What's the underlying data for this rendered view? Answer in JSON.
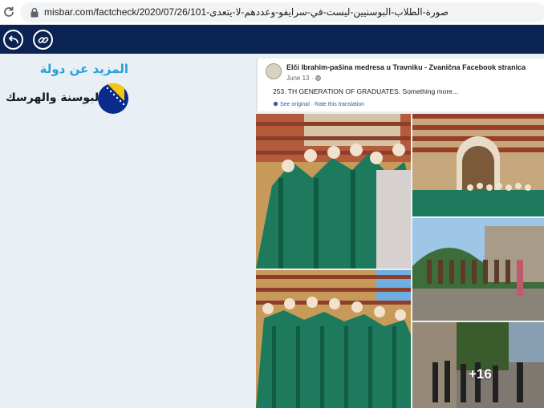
{
  "browser": {
    "url": "misbar.com/factcheck/2020/07/26/101-صورة-الطلاب-البوسنيين-ليست-في-سرايفو-وعددهم-لا-يتعدى",
    "icons": {
      "reload": "reload-icon",
      "lock": "lock-icon"
    }
  },
  "toolbar": {
    "icons": [
      "back-arrow-icon",
      "link-icon"
    ],
    "color": "#0b2352"
  },
  "sidebar": {
    "heading": "المزيد عن دولة",
    "country": "البوسنة والهرسك",
    "flag_icon": "bosnia-flag-icon",
    "heading_color": "#2a9fd8"
  },
  "facebook_post": {
    "page_name": "Elči Ibrahim-pašina medresa u Travniku - Zvanična Facebook stranica",
    "date": "June 13 · ",
    "text": "253. TH GENERATION OF GRADUATES. Something more...",
    "see_original": "See original",
    "separator": " · ",
    "rate_translation": "Rate this translation",
    "more_photos": "+16"
  }
}
